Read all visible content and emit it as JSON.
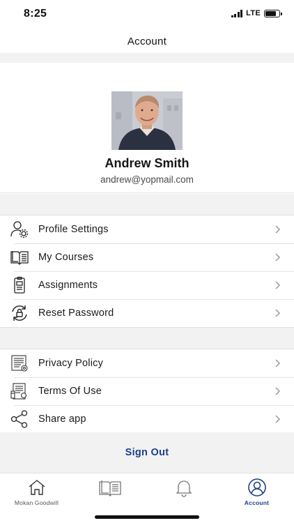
{
  "status_bar": {
    "time": "8:25",
    "network": "LTE",
    "battery_level": 0.8
  },
  "header": {
    "title": "Account"
  },
  "profile": {
    "name": "Andrew Smith",
    "email": "andrew@yopmail.com"
  },
  "menu_group_1": [
    {
      "label": "Profile Settings",
      "icon": "user-settings-icon"
    },
    {
      "label": "My Courses",
      "icon": "book-icon"
    },
    {
      "label": "Assignments",
      "icon": "assignment-icon"
    },
    {
      "label": "Reset Password",
      "icon": "reset-password-icon"
    }
  ],
  "menu_group_2": [
    {
      "label": "Privacy Policy",
      "icon": "privacy-policy-icon"
    },
    {
      "label": "Terms Of Use",
      "icon": "terms-of-use-icon"
    },
    {
      "label": "Share app",
      "icon": "share-icon"
    }
  ],
  "sign_out": {
    "label": "Sign Out"
  },
  "tab_bar": {
    "tabs": [
      {
        "label": "Mokan Goodwill",
        "icon": "home-icon",
        "active": false
      },
      {
        "label": "",
        "icon": "book-icon",
        "active": false
      },
      {
        "label": "",
        "icon": "bell-icon",
        "active": false
      },
      {
        "label": "Account",
        "icon": "account-icon",
        "active": true
      }
    ]
  },
  "colors": {
    "accent": "#1c3f8c",
    "background_gray": "#f2f2f2",
    "divider": "#e4e4e4"
  }
}
